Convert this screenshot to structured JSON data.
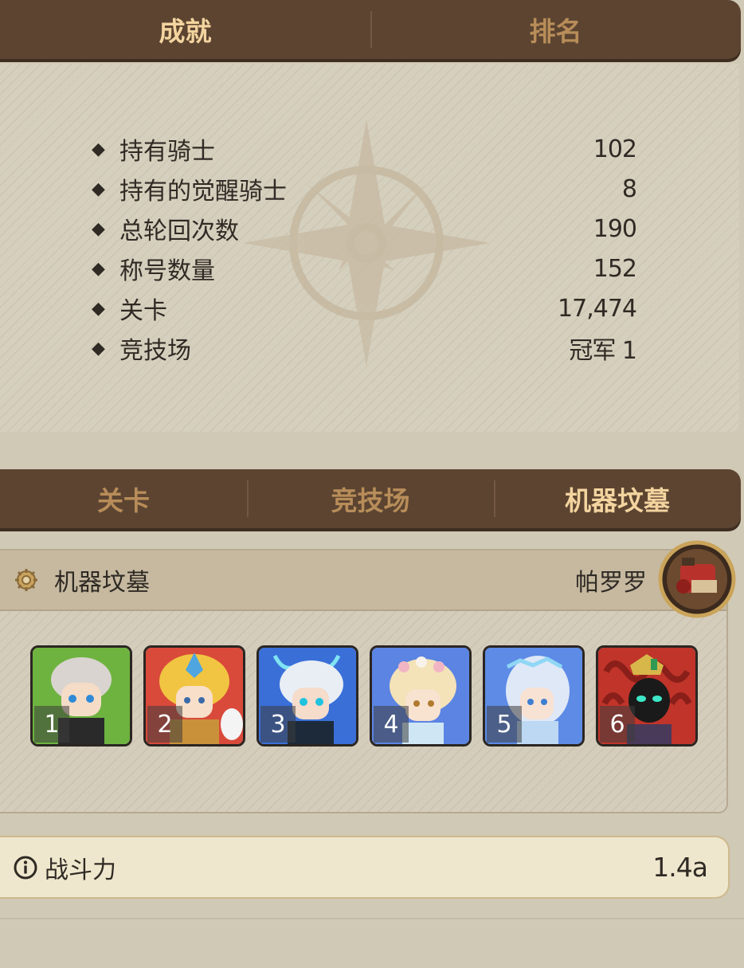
{
  "top_tabs": [
    {
      "label": "成就",
      "active": true
    },
    {
      "label": "排名",
      "active": false
    }
  ],
  "stats": [
    {
      "label": "持有骑士",
      "value": "102"
    },
    {
      "label": "持有的觉醒骑士",
      "value": "8"
    },
    {
      "label": "总轮回次数",
      "value": "190"
    },
    {
      "label": "称号数量",
      "value": "152"
    },
    {
      "label": "关卡",
      "value": "17,474"
    },
    {
      "label": "竞技场",
      "value": "冠军 1"
    }
  ],
  "mode_tabs": [
    {
      "label": "关卡",
      "active": false
    },
    {
      "label": "竞技场",
      "active": false
    },
    {
      "label": "机器坟墓",
      "active": true
    }
  ],
  "team": {
    "title": "机器坟墓",
    "owner": "帕罗罗",
    "heroes": [
      {
        "slot": "1",
        "bg": "#6eb33f",
        "hair": "#d9d4cf"
      },
      {
        "slot": "2",
        "bg": "#d94a3a",
        "hair": "#f1c542"
      },
      {
        "slot": "3",
        "bg": "#3a6fd8",
        "hair": "#e9eef5"
      },
      {
        "slot": "4",
        "bg": "#5b84e3",
        "hair": "#f4e2b8"
      },
      {
        "slot": "5",
        "bg": "#5d8be6",
        "hair": "#dfe8f6"
      },
      {
        "slot": "6",
        "bg": "#c0342a",
        "hair": "#8a1f1a"
      }
    ]
  },
  "power": {
    "label": "战斗力",
    "value": "1.4a"
  },
  "colors": {
    "tab_bar": "#5c4431",
    "tab_active": "#f3d49f",
    "tab_inactive": "#b88d59",
    "text": "#2f2a24"
  }
}
